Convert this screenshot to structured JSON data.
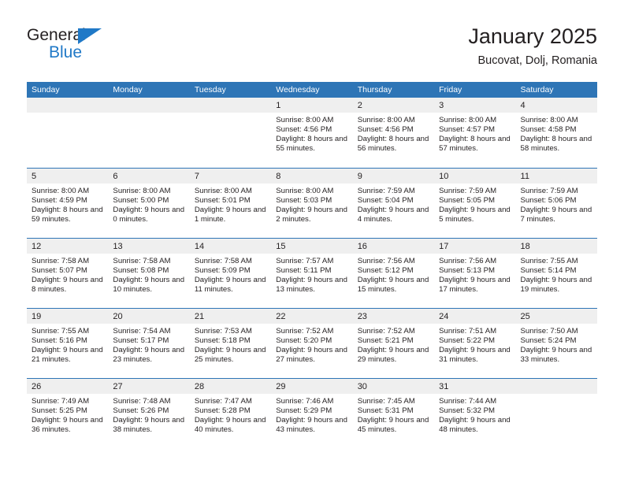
{
  "logo": {
    "word_one": "General",
    "word_two": "Blue",
    "triangle_icon": "blue-triangle-icon",
    "accent_color": "#2079c7"
  },
  "header": {
    "title": "January 2025",
    "subtitle": "Bucovat, Dolj, Romania"
  },
  "theme": {
    "header_bar_color": "#2e75b6",
    "day_strip_color": "#efefef",
    "text_color": "#231f20",
    "page_background": "#ffffff"
  },
  "weekdays": [
    "Sunday",
    "Monday",
    "Tuesday",
    "Wednesday",
    "Thursday",
    "Friday",
    "Saturday"
  ],
  "weeks": [
    [
      {
        "day": "",
        "empty": true
      },
      {
        "day": "",
        "empty": true
      },
      {
        "day": "",
        "empty": true
      },
      {
        "day": "1",
        "sunrise": "Sunrise: 8:00 AM",
        "sunset": "Sunset: 4:56 PM",
        "daylight": "Daylight: 8 hours and 55 minutes."
      },
      {
        "day": "2",
        "sunrise": "Sunrise: 8:00 AM",
        "sunset": "Sunset: 4:56 PM",
        "daylight": "Daylight: 8 hours and 56 minutes."
      },
      {
        "day": "3",
        "sunrise": "Sunrise: 8:00 AM",
        "sunset": "Sunset: 4:57 PM",
        "daylight": "Daylight: 8 hours and 57 minutes."
      },
      {
        "day": "4",
        "sunrise": "Sunrise: 8:00 AM",
        "sunset": "Sunset: 4:58 PM",
        "daylight": "Daylight: 8 hours and 58 minutes."
      }
    ],
    [
      {
        "day": "5",
        "sunrise": "Sunrise: 8:00 AM",
        "sunset": "Sunset: 4:59 PM",
        "daylight": "Daylight: 8 hours and 59 minutes."
      },
      {
        "day": "6",
        "sunrise": "Sunrise: 8:00 AM",
        "sunset": "Sunset: 5:00 PM",
        "daylight": "Daylight: 9 hours and 0 minutes."
      },
      {
        "day": "7",
        "sunrise": "Sunrise: 8:00 AM",
        "sunset": "Sunset: 5:01 PM",
        "daylight": "Daylight: 9 hours and 1 minute."
      },
      {
        "day": "8",
        "sunrise": "Sunrise: 8:00 AM",
        "sunset": "Sunset: 5:03 PM",
        "daylight": "Daylight: 9 hours and 2 minutes."
      },
      {
        "day": "9",
        "sunrise": "Sunrise: 7:59 AM",
        "sunset": "Sunset: 5:04 PM",
        "daylight": "Daylight: 9 hours and 4 minutes."
      },
      {
        "day": "10",
        "sunrise": "Sunrise: 7:59 AM",
        "sunset": "Sunset: 5:05 PM",
        "daylight": "Daylight: 9 hours and 5 minutes."
      },
      {
        "day": "11",
        "sunrise": "Sunrise: 7:59 AM",
        "sunset": "Sunset: 5:06 PM",
        "daylight": "Daylight: 9 hours and 7 minutes."
      }
    ],
    [
      {
        "day": "12",
        "sunrise": "Sunrise: 7:58 AM",
        "sunset": "Sunset: 5:07 PM",
        "daylight": "Daylight: 9 hours and 8 minutes."
      },
      {
        "day": "13",
        "sunrise": "Sunrise: 7:58 AM",
        "sunset": "Sunset: 5:08 PM",
        "daylight": "Daylight: 9 hours and 10 minutes."
      },
      {
        "day": "14",
        "sunrise": "Sunrise: 7:58 AM",
        "sunset": "Sunset: 5:09 PM",
        "daylight": "Daylight: 9 hours and 11 minutes."
      },
      {
        "day": "15",
        "sunrise": "Sunrise: 7:57 AM",
        "sunset": "Sunset: 5:11 PM",
        "daylight": "Daylight: 9 hours and 13 minutes."
      },
      {
        "day": "16",
        "sunrise": "Sunrise: 7:56 AM",
        "sunset": "Sunset: 5:12 PM",
        "daylight": "Daylight: 9 hours and 15 minutes."
      },
      {
        "day": "17",
        "sunrise": "Sunrise: 7:56 AM",
        "sunset": "Sunset: 5:13 PM",
        "daylight": "Daylight: 9 hours and 17 minutes."
      },
      {
        "day": "18",
        "sunrise": "Sunrise: 7:55 AM",
        "sunset": "Sunset: 5:14 PM",
        "daylight": "Daylight: 9 hours and 19 minutes."
      }
    ],
    [
      {
        "day": "19",
        "sunrise": "Sunrise: 7:55 AM",
        "sunset": "Sunset: 5:16 PM",
        "daylight": "Daylight: 9 hours and 21 minutes."
      },
      {
        "day": "20",
        "sunrise": "Sunrise: 7:54 AM",
        "sunset": "Sunset: 5:17 PM",
        "daylight": "Daylight: 9 hours and 23 minutes."
      },
      {
        "day": "21",
        "sunrise": "Sunrise: 7:53 AM",
        "sunset": "Sunset: 5:18 PM",
        "daylight": "Daylight: 9 hours and 25 minutes."
      },
      {
        "day": "22",
        "sunrise": "Sunrise: 7:52 AM",
        "sunset": "Sunset: 5:20 PM",
        "daylight": "Daylight: 9 hours and 27 minutes."
      },
      {
        "day": "23",
        "sunrise": "Sunrise: 7:52 AM",
        "sunset": "Sunset: 5:21 PM",
        "daylight": "Daylight: 9 hours and 29 minutes."
      },
      {
        "day": "24",
        "sunrise": "Sunrise: 7:51 AM",
        "sunset": "Sunset: 5:22 PM",
        "daylight": "Daylight: 9 hours and 31 minutes."
      },
      {
        "day": "25",
        "sunrise": "Sunrise: 7:50 AM",
        "sunset": "Sunset: 5:24 PM",
        "daylight": "Daylight: 9 hours and 33 minutes."
      }
    ],
    [
      {
        "day": "26",
        "sunrise": "Sunrise: 7:49 AM",
        "sunset": "Sunset: 5:25 PM",
        "daylight": "Daylight: 9 hours and 36 minutes."
      },
      {
        "day": "27",
        "sunrise": "Sunrise: 7:48 AM",
        "sunset": "Sunset: 5:26 PM",
        "daylight": "Daylight: 9 hours and 38 minutes."
      },
      {
        "day": "28",
        "sunrise": "Sunrise: 7:47 AM",
        "sunset": "Sunset: 5:28 PM",
        "daylight": "Daylight: 9 hours and 40 minutes."
      },
      {
        "day": "29",
        "sunrise": "Sunrise: 7:46 AM",
        "sunset": "Sunset: 5:29 PM",
        "daylight": "Daylight: 9 hours and 43 minutes."
      },
      {
        "day": "30",
        "sunrise": "Sunrise: 7:45 AM",
        "sunset": "Sunset: 5:31 PM",
        "daylight": "Daylight: 9 hours and 45 minutes."
      },
      {
        "day": "31",
        "sunrise": "Sunrise: 7:44 AM",
        "sunset": "Sunset: 5:32 PM",
        "daylight": "Daylight: 9 hours and 48 minutes."
      },
      {
        "day": "",
        "empty": true
      }
    ]
  ]
}
